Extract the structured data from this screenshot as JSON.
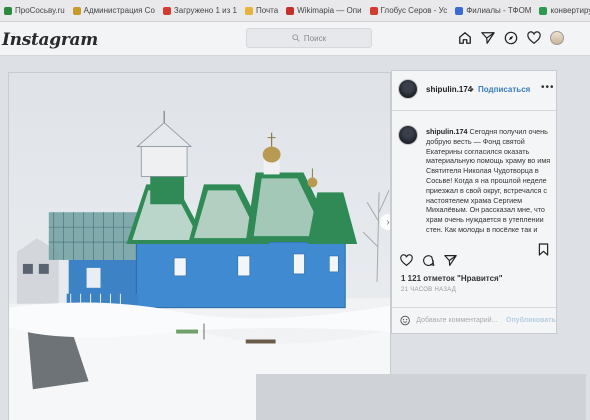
{
  "bookmarks": [
    {
      "label": "ПроСосьву.ru",
      "color": "#2a8a3e"
    },
    {
      "label": "Администрация Со",
      "color": "#c79b2a"
    },
    {
      "label": "Загружено 1 из 1",
      "color": "#d43a2f"
    },
    {
      "label": "Почта",
      "color": "#e8b33b"
    },
    {
      "label": "Wikimapia — Опи",
      "color": "#c4302b"
    },
    {
      "label": "Глобус Серов - Ус",
      "color": "#d43a2f"
    },
    {
      "label": "Филиалы - ТФОМ",
      "color": "#3a6ad4"
    },
    {
      "label": "конвертируйте мн",
      "color": "#2a9a4e"
    }
  ],
  "header": {
    "logo": "Instagram",
    "search_placeholder": "Поиск"
  },
  "post": {
    "username": "shipulin.174",
    "follow_label": "Подписаться",
    "dot": "•",
    "more": "•••",
    "caption_user": "shipulin.174",
    "caption_text": "Сегодня получил очень добрую весть — Фонд святой Екатерины согласился оказать материальную помощь храму во имя Святителя Николая Чудотворца в Сосьве! Когда я на прошлой неделе приезжал в свой округ, встречался с настоятелем храма Сергием Михалёвым. Он рассказал мне, что храм очень нуждается в утеплении стен. Как молоды в посёлке так и",
    "likes": "1 121 отметок \"Нравится\"",
    "time": "21 ЧАСОВ НАЗАД",
    "comment_placeholder": "Добавьте комментарий...",
    "publish_label": "Опубликовать"
  },
  "icons": {
    "home": "home-icon",
    "direct": "direct-icon",
    "explore": "compass-icon",
    "activity": "heart-icon",
    "search": "search-icon",
    "like": "heart-icon",
    "comment": "comment-icon",
    "share": "share-icon",
    "save": "bookmark-icon",
    "emoji": "smiley-icon",
    "next": "chevron-right-icon"
  }
}
